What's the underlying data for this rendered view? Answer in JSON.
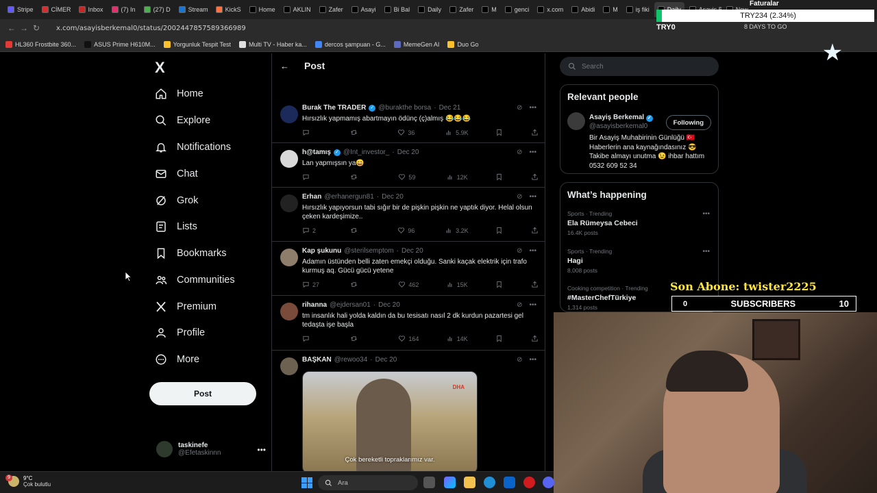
{
  "browser": {
    "tabs": [
      {
        "label": "Stripe",
        "color": "#635bff"
      },
      {
        "label": "CİMER",
        "color": "#d32f2f"
      },
      {
        "label": "Inbox",
        "color": "#c62828"
      },
      {
        "label": "(7) In",
        "color": "#e1306c"
      },
      {
        "label": "(27) D",
        "color": "#4caf50"
      },
      {
        "label": "Stream",
        "color": "#1976d2"
      },
      {
        "label": "KickS",
        "color": "#ff7043"
      },
      {
        "label": "Home",
        "color": "#000000"
      },
      {
        "label": "AKLIN",
        "color": "#000000"
      },
      {
        "label": "Zafer",
        "color": "#000000"
      },
      {
        "label": "Asayi",
        "color": "#000000"
      },
      {
        "label": "Bi Bal",
        "color": "#000000"
      },
      {
        "label": "Daily",
        "color": "#000000"
      },
      {
        "label": "Zafer",
        "color": "#000000"
      },
      {
        "label": "M",
        "color": "#000000"
      },
      {
        "label": "genci",
        "color": "#000000"
      },
      {
        "label": "x.com",
        "color": "#000000"
      },
      {
        "label": "Abidi",
        "color": "#000000"
      },
      {
        "label": "M",
        "color": "#000000"
      },
      {
        "label": "iş fiki",
        "color": "#000000"
      },
      {
        "label": "Daily",
        "color": "#000000",
        "active": true
      },
      {
        "label": "Asayiş Ber",
        "color": "#000000"
      },
      {
        "label": "New",
        "color": "#000000"
      }
    ],
    "url": "x.com/asayisberkemal0/status/2002447857589366989",
    "days_to_go": "8 DAYS TO GO",
    "bookmarks": [
      {
        "label": "HL360 Frostbite 360...",
        "color": "#e53935"
      },
      {
        "label": "ASUS Prime H610M...",
        "color": "#111111"
      },
      {
        "label": "Yorgunluk Tespit Test",
        "color": "#fbc02d"
      },
      {
        "label": "Multi TV - Haber ka...",
        "color": "#e0e0e0"
      },
      {
        "label": "dercos şampuan - G...",
        "color": "#4285f4"
      },
      {
        "label": "MemeGen AI",
        "color": "#5c6bc0"
      },
      {
        "label": "Duo Go",
        "color": "#fbc02d"
      }
    ]
  },
  "leftnav": {
    "logo": "X",
    "items": [
      {
        "label": "Home",
        "icon": "home-icon"
      },
      {
        "label": "Explore",
        "icon": "search-icon"
      },
      {
        "label": "Notifications",
        "icon": "bell-icon"
      },
      {
        "label": "Chat",
        "icon": "mail-icon"
      },
      {
        "label": "Grok",
        "icon": "grok-icon"
      },
      {
        "label": "Lists",
        "icon": "list-icon"
      },
      {
        "label": "Bookmarks",
        "icon": "bookmark-icon"
      },
      {
        "label": "Communities",
        "icon": "people-icon"
      },
      {
        "label": "Premium",
        "icon": "x-icon"
      },
      {
        "label": "Profile",
        "icon": "person-icon"
      },
      {
        "label": "More",
        "icon": "more-circle-icon"
      }
    ],
    "post_button": "Post",
    "account": {
      "name": "taskinefe",
      "handle": "@Efetaskinnn"
    }
  },
  "center": {
    "header_title": "Post",
    "tweets": [
      {
        "name": "Burak The TRADER",
        "verified": true,
        "handle": "@burakthe borsa",
        "date": "Dec 21",
        "text": "Hırsızlık yapmamış abartmayın ödünç (ç)almış 😂😂😂",
        "replies": "",
        "likes": "36",
        "views": "5.9K",
        "avatar_color": "#1b2a5a"
      },
      {
        "name": "h@tamış",
        "verified": true,
        "handle": "@Int_investor_",
        "date": "Dec 20",
        "text": "Lan yapmışsın ya😄",
        "replies": "",
        "likes": "59",
        "views": "12K",
        "avatar_color": "#d9d9d9"
      },
      {
        "name": "Erhan",
        "verified": false,
        "handle": "@erhanergun81",
        "date": "Dec 20",
        "text": "Hırsızlık yapıyorsun tabi sığır bir de pişkin pişkin ne yaptık diyor. Helal olsun çeken kardeşimize..",
        "replies": "2",
        "likes": "96",
        "views": "3.2K",
        "avatar_color": "#222222"
      },
      {
        "name": "Kap şukunu",
        "verified": false,
        "handle": "@sterilsemptom",
        "date": "Dec 20",
        "text": "Adamın üstünden belli zaten emekçi olduğu. Sanki kaçak elektrik için trafo kurmuş aq. Gücü gücü yetene",
        "replies": "27",
        "likes": "462",
        "views": "15K",
        "avatar_color": "#8d7d6a"
      },
      {
        "name": "rihanna",
        "verified": false,
        "handle": "@ejdersan01",
        "date": "Dec 20",
        "text": "tm insanlık hali yolda kaldın da bu tesisatı nasıl 2 dk kurdun pazartesi gel tedaşta işe başla",
        "replies": "",
        "likes": "164",
        "views": "14K",
        "avatar_color": "#7a4a3a"
      },
      {
        "name": "BAŞKAN",
        "verified": false,
        "handle": "@rewoo34",
        "date": "Dec 20",
        "text": "",
        "replies": "",
        "likes": "",
        "views": "",
        "avatar_color": "#6d6252",
        "media_caption": "Çok bereketli topraklarımız var.",
        "media_logo": "DHA"
      }
    ]
  },
  "right": {
    "search_placeholder": "Search",
    "relevant_title": "Relevant people",
    "person": {
      "name": "Asayiş Berkemal",
      "handle": "@asayisberkemal0",
      "follow_label": "Following",
      "bio": "Bir Asayiş Muhabirinin Günlüğü 🇹🇷 Haberlerin ana kaynağındasınız 😎 Takibe almayı unutma 😉 ihbar hattım 0532 609 52 34"
    },
    "happening_title": "What’s happening",
    "trends": [
      {
        "category": "Sports · Trending",
        "name": "Ela Rümeysa Cebeci",
        "posts": "16.4K posts"
      },
      {
        "category": "Sports · Trending",
        "name": "Hagi",
        "posts": "8,008 posts"
      },
      {
        "category": "Cooking competition · Trending",
        "name": "#MasterChefTürkiye",
        "posts": "1,314 posts"
      }
    ]
  },
  "overlay": {
    "ticker": "TRY234 (2.34%)",
    "faturalar": "Faturalar",
    "try0": "TRY0",
    "son_abone": "Son Abone: twister2225",
    "subs_label": "SUBSCRIBERS",
    "subs_left": "0",
    "subs_count": "10"
  },
  "taskbar": {
    "badge": "9",
    "temp": "9°C",
    "condition": "Çok bulutlu",
    "search_label": "Ara"
  }
}
